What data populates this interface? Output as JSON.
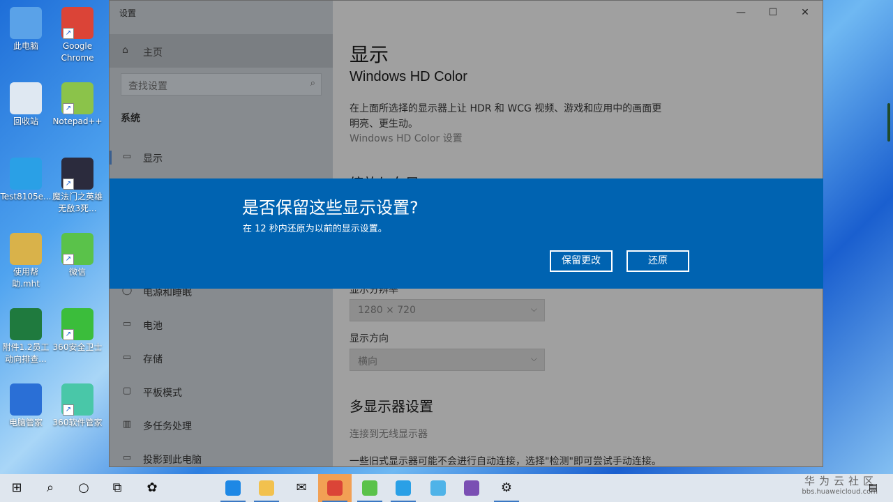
{
  "desktop": {
    "icons": [
      {
        "label": "此电脑",
        "icon": "computer-icon",
        "color": "#5aa2e8",
        "shortcut": false
      },
      {
        "label": "Google Chrome",
        "icon": "chrome-icon",
        "color": "#db4437",
        "shortcut": true
      },
      {
        "label": "回收站",
        "icon": "recycle-bin-icon",
        "color": "#dfe8f2",
        "shortcut": false
      },
      {
        "label": "Notepad++",
        "icon": "notepadpp-icon",
        "color": "#8bc34a",
        "shortcut": true
      },
      {
        "label": "Test8105e...",
        "icon": "ie-icon",
        "color": "#2aa0e6",
        "shortcut": false
      },
      {
        "label": "魔法门之英雄无敌3死...",
        "icon": "game-icon",
        "color": "#2b2b3d",
        "shortcut": true
      },
      {
        "label": "使用帮助.mht",
        "icon": "help-file-icon",
        "color": "#d9b24a",
        "shortcut": false
      },
      {
        "label": "微信",
        "icon": "wechat-icon",
        "color": "#5ac24a",
        "shortcut": true
      },
      {
        "label": "附件1.2员工动向排查...",
        "icon": "excel-icon",
        "color": "#1f7a3e",
        "shortcut": false
      },
      {
        "label": "360安全卫士",
        "icon": "360-security-icon",
        "color": "#3bbd3b",
        "shortcut": true
      },
      {
        "label": "电脑管家",
        "icon": "pc-manager-icon",
        "color": "#2a6fd6",
        "shortcut": false
      },
      {
        "label": "360软件管家",
        "icon": "360-software-icon",
        "color": "#49c7a8",
        "shortcut": true
      }
    ]
  },
  "window": {
    "title": "设置",
    "minimize": "—",
    "maximize": "☐",
    "close": "✕"
  },
  "sidebar": {
    "home": "主页",
    "search_placeholder": "查找设置",
    "section": "系统",
    "items": [
      {
        "label": "显示",
        "icon": "monitor-icon",
        "selected": true
      },
      {
        "label": "电源和睡眠",
        "icon": "power-icon"
      },
      {
        "label": "电池",
        "icon": "battery-icon"
      },
      {
        "label": "存储",
        "icon": "storage-icon"
      },
      {
        "label": "平板模式",
        "icon": "tablet-icon"
      },
      {
        "label": "多任务处理",
        "icon": "multitask-icon"
      },
      {
        "label": "投影到此电脑",
        "icon": "project-icon"
      }
    ]
  },
  "content": {
    "title": "显示",
    "subtitle": "Windows HD Color",
    "description": "在上面所选择的显示器上让 HDR 和 WCG 视频、游戏和应用中的画面更明亮、更生动。",
    "hd_link": "Windows HD Color 设置",
    "partial_heading": "缩放与布局",
    "resolution_label": "显示分辨率",
    "resolution_value": "1280 × 720",
    "orientation_label": "显示方向",
    "orientation_value": "横向",
    "multi_heading": "多显示器设置",
    "wireless_link": "连接到无线显示器",
    "old_display_note": "一些旧式显示器可能不会进行自动连接，选择\"检测\"即可尝试手动连接。"
  },
  "dialog": {
    "title": "是否保留这些显示设置?",
    "message": "在 12 秒内还原为以前的显示设置。",
    "keep_button": "保留更改",
    "revert_button": "还原",
    "accent": "#0063b1"
  },
  "taskbar": {
    "items": [
      {
        "name": "start-icon",
        "glyph": "⊞"
      },
      {
        "name": "search-icon",
        "glyph": "⌕"
      },
      {
        "name": "cortana-icon",
        "glyph": "○"
      },
      {
        "name": "task-view-icon",
        "glyph": "⧉"
      },
      {
        "name": "app-icon",
        "glyph": "✿"
      },
      {
        "name": "edge-icon",
        "glyph": "e"
      },
      {
        "name": "file-explorer-icon",
        "glyph": "▭"
      },
      {
        "name": "mail-icon",
        "glyph": "✉"
      },
      {
        "name": "chrome-icon",
        "glyph": "◉"
      },
      {
        "name": "wechat-icon",
        "glyph": "◎"
      },
      {
        "name": "cloud-app-icon",
        "glyph": "☁"
      },
      {
        "name": "cloud-drive-icon",
        "glyph": "☁"
      },
      {
        "name": "winrar-icon",
        "glyph": "▥"
      },
      {
        "name": "settings-icon",
        "glyph": "⚙"
      }
    ],
    "watermark_main": "华为云社区",
    "watermark_sub": "bbs.huaweicloud.com",
    "notification": "▤"
  }
}
